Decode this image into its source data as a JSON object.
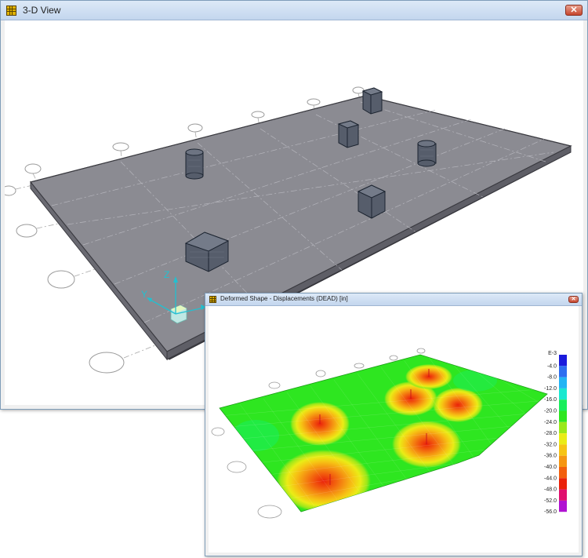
{
  "main_window": {
    "title": "3-D View",
    "close_glyph": "✕",
    "axis_labels": {
      "x": "X",
      "y": "Y",
      "z": "Z"
    }
  },
  "deformed_window": {
    "title": "Deformed Shape - Displacements (DEAD)  [in]",
    "close_glyph": "✕",
    "legend": {
      "exponent": "E-3",
      "items": [
        {
          "label": "-4.0",
          "color": "#1a1adc"
        },
        {
          "label": "-8.0",
          "color": "#2d6ef0"
        },
        {
          "label": "-12.0",
          "color": "#22b4f4"
        },
        {
          "label": "-16.0",
          "color": "#1ae8d0"
        },
        {
          "label": "-20.0",
          "color": "#19ee5c"
        },
        {
          "label": "-24.0",
          "color": "#2ee620"
        },
        {
          "label": "-28.0",
          "color": "#9ae81a"
        },
        {
          "label": "-32.0",
          "color": "#eaec16"
        },
        {
          "label": "-36.0",
          "color": "#f6c414"
        },
        {
          "label": "-40.0",
          "color": "#f59612"
        },
        {
          "label": "-44.0",
          "color": "#f2600e"
        },
        {
          "label": "-48.0",
          "color": "#ea220a"
        },
        {
          "label": "-52.0",
          "color": "#e0106e"
        },
        {
          "label": "-56.0",
          "color": "#b012d2"
        }
      ]
    }
  }
}
